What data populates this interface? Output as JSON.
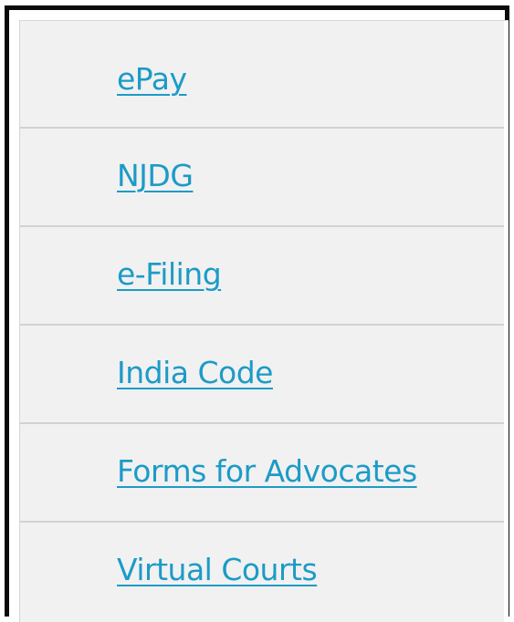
{
  "menu": {
    "items": [
      {
        "label": "ePay"
      },
      {
        "label": "NJDG"
      },
      {
        "label": "e-Filing"
      },
      {
        "label": "India Code"
      },
      {
        "label": "Forms for Advocates"
      },
      {
        "label": "Virtual Courts"
      }
    ]
  },
  "colors": {
    "link": "#1c9bc7",
    "panel_background": "#f1f1f1",
    "divider": "#d2d2d2",
    "frame_border": "#0b0b0b"
  }
}
